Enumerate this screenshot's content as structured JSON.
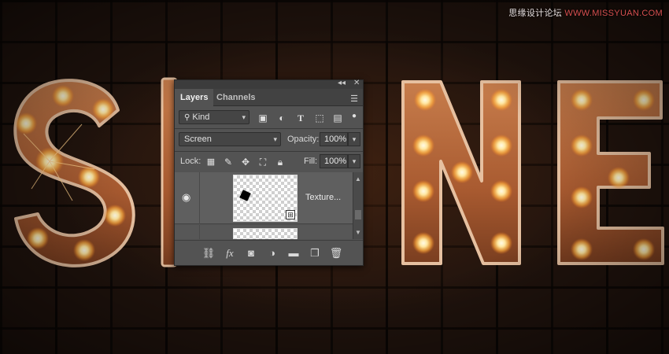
{
  "watermark": {
    "part1": "思缘设计论坛",
    "part2": "WWW.MISSYUAN.COM"
  },
  "panel": {
    "tabs": [
      {
        "label": "Layers",
        "active": true
      },
      {
        "label": "Channels",
        "active": false
      }
    ],
    "filter": {
      "kind_label": "Kind",
      "filter_icons": [
        "image-filter-icon",
        "adjustment-filter-icon",
        "type-filter-icon",
        "shape-filter-icon",
        "smart-object-filter-icon",
        "filter-toggle-icon"
      ]
    },
    "blend_mode": "Screen",
    "opacity_label": "Opacity:",
    "opacity_value": "100%",
    "lock_label": "Lock:",
    "lock_icons": [
      "lock-transparent-pixels-icon",
      "lock-image-pixels-icon",
      "lock-position-icon",
      "lock-artboard-icon",
      "lock-all-icon"
    ],
    "fill_label": "Fill:",
    "fill_value": "100%",
    "layers": [
      {
        "name": "Texture...",
        "visible": true,
        "smart_object": true
      }
    ],
    "bottom_icons": [
      "link-layers-icon",
      "fx-icon",
      "add-mask-icon",
      "new-fill-adjustment-icon",
      "new-group-icon",
      "new-layer-icon",
      "delete-layer-icon"
    ],
    "fx_label": "fx"
  },
  "colors": {
    "panel_bg": "#535353",
    "bulb_core": "#fff6d0",
    "bulb_glow": "#ffb040",
    "letter_face": "#b86a3c",
    "letter_rim": "#e8c2a0"
  }
}
